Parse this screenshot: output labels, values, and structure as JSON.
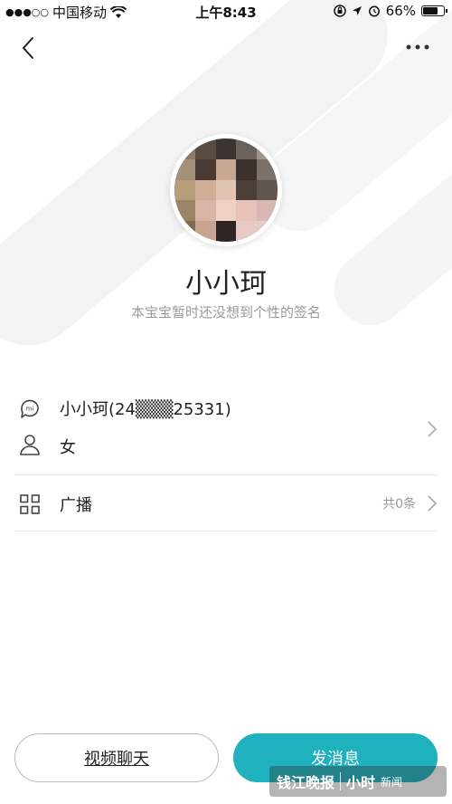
{
  "status_bar": {
    "carrier": "中国移动",
    "time": "上午8:43",
    "battery": "66%",
    "battery_level": 0.66
  },
  "profile": {
    "nickname": "小小珂",
    "signature": "本宝宝暂时还没想到个性的签名"
  },
  "info": {
    "account": "小小珂(24▒▒▒25331)",
    "gender": "女"
  },
  "broadcast": {
    "label": "广播",
    "count": "共0条"
  },
  "actions": {
    "video_chat": "视频聊天",
    "send_message": "发消息"
  },
  "watermark": {
    "brand": "钱江晚报",
    "sub": "小时",
    "tag": "新闻"
  },
  "colors": {
    "accent": "#1fb1bd"
  }
}
